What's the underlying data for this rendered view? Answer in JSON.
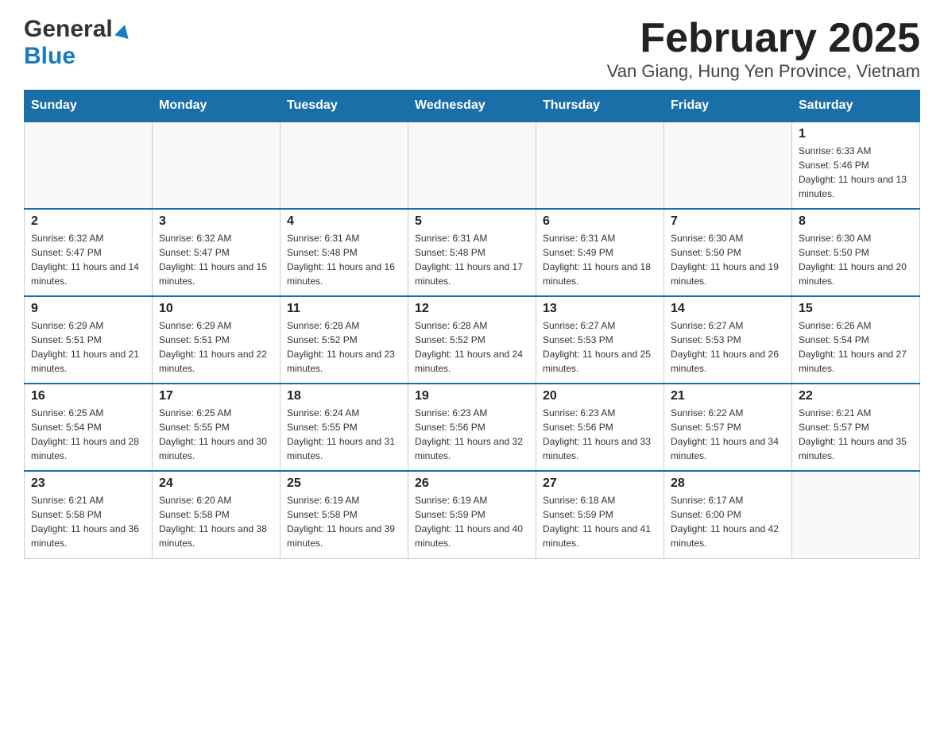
{
  "header": {
    "logo_general": "General",
    "logo_blue": "Blue",
    "title": "February 2025",
    "subtitle": "Van Giang, Hung Yen Province, Vietnam"
  },
  "calendar": {
    "days_of_week": [
      "Sunday",
      "Monday",
      "Tuesday",
      "Wednesday",
      "Thursday",
      "Friday",
      "Saturday"
    ],
    "weeks": [
      [
        {
          "day": "",
          "info": ""
        },
        {
          "day": "",
          "info": ""
        },
        {
          "day": "",
          "info": ""
        },
        {
          "day": "",
          "info": ""
        },
        {
          "day": "",
          "info": ""
        },
        {
          "day": "",
          "info": ""
        },
        {
          "day": "1",
          "info": "Sunrise: 6:33 AM\nSunset: 5:46 PM\nDaylight: 11 hours and 13 minutes."
        }
      ],
      [
        {
          "day": "2",
          "info": "Sunrise: 6:32 AM\nSunset: 5:47 PM\nDaylight: 11 hours and 14 minutes."
        },
        {
          "day": "3",
          "info": "Sunrise: 6:32 AM\nSunset: 5:47 PM\nDaylight: 11 hours and 15 minutes."
        },
        {
          "day": "4",
          "info": "Sunrise: 6:31 AM\nSunset: 5:48 PM\nDaylight: 11 hours and 16 minutes."
        },
        {
          "day": "5",
          "info": "Sunrise: 6:31 AM\nSunset: 5:48 PM\nDaylight: 11 hours and 17 minutes."
        },
        {
          "day": "6",
          "info": "Sunrise: 6:31 AM\nSunset: 5:49 PM\nDaylight: 11 hours and 18 minutes."
        },
        {
          "day": "7",
          "info": "Sunrise: 6:30 AM\nSunset: 5:50 PM\nDaylight: 11 hours and 19 minutes."
        },
        {
          "day": "8",
          "info": "Sunrise: 6:30 AM\nSunset: 5:50 PM\nDaylight: 11 hours and 20 minutes."
        }
      ],
      [
        {
          "day": "9",
          "info": "Sunrise: 6:29 AM\nSunset: 5:51 PM\nDaylight: 11 hours and 21 minutes."
        },
        {
          "day": "10",
          "info": "Sunrise: 6:29 AM\nSunset: 5:51 PM\nDaylight: 11 hours and 22 minutes."
        },
        {
          "day": "11",
          "info": "Sunrise: 6:28 AM\nSunset: 5:52 PM\nDaylight: 11 hours and 23 minutes."
        },
        {
          "day": "12",
          "info": "Sunrise: 6:28 AM\nSunset: 5:52 PM\nDaylight: 11 hours and 24 minutes."
        },
        {
          "day": "13",
          "info": "Sunrise: 6:27 AM\nSunset: 5:53 PM\nDaylight: 11 hours and 25 minutes."
        },
        {
          "day": "14",
          "info": "Sunrise: 6:27 AM\nSunset: 5:53 PM\nDaylight: 11 hours and 26 minutes."
        },
        {
          "day": "15",
          "info": "Sunrise: 6:26 AM\nSunset: 5:54 PM\nDaylight: 11 hours and 27 minutes."
        }
      ],
      [
        {
          "day": "16",
          "info": "Sunrise: 6:25 AM\nSunset: 5:54 PM\nDaylight: 11 hours and 28 minutes."
        },
        {
          "day": "17",
          "info": "Sunrise: 6:25 AM\nSunset: 5:55 PM\nDaylight: 11 hours and 30 minutes."
        },
        {
          "day": "18",
          "info": "Sunrise: 6:24 AM\nSunset: 5:55 PM\nDaylight: 11 hours and 31 minutes."
        },
        {
          "day": "19",
          "info": "Sunrise: 6:23 AM\nSunset: 5:56 PM\nDaylight: 11 hours and 32 minutes."
        },
        {
          "day": "20",
          "info": "Sunrise: 6:23 AM\nSunset: 5:56 PM\nDaylight: 11 hours and 33 minutes."
        },
        {
          "day": "21",
          "info": "Sunrise: 6:22 AM\nSunset: 5:57 PM\nDaylight: 11 hours and 34 minutes."
        },
        {
          "day": "22",
          "info": "Sunrise: 6:21 AM\nSunset: 5:57 PM\nDaylight: 11 hours and 35 minutes."
        }
      ],
      [
        {
          "day": "23",
          "info": "Sunrise: 6:21 AM\nSunset: 5:58 PM\nDaylight: 11 hours and 36 minutes."
        },
        {
          "day": "24",
          "info": "Sunrise: 6:20 AM\nSunset: 5:58 PM\nDaylight: 11 hours and 38 minutes."
        },
        {
          "day": "25",
          "info": "Sunrise: 6:19 AM\nSunset: 5:58 PM\nDaylight: 11 hours and 39 minutes."
        },
        {
          "day": "26",
          "info": "Sunrise: 6:19 AM\nSunset: 5:59 PM\nDaylight: 11 hours and 40 minutes."
        },
        {
          "day": "27",
          "info": "Sunrise: 6:18 AM\nSunset: 5:59 PM\nDaylight: 11 hours and 41 minutes."
        },
        {
          "day": "28",
          "info": "Sunrise: 6:17 AM\nSunset: 6:00 PM\nDaylight: 11 hours and 42 minutes."
        },
        {
          "day": "",
          "info": ""
        }
      ]
    ]
  }
}
